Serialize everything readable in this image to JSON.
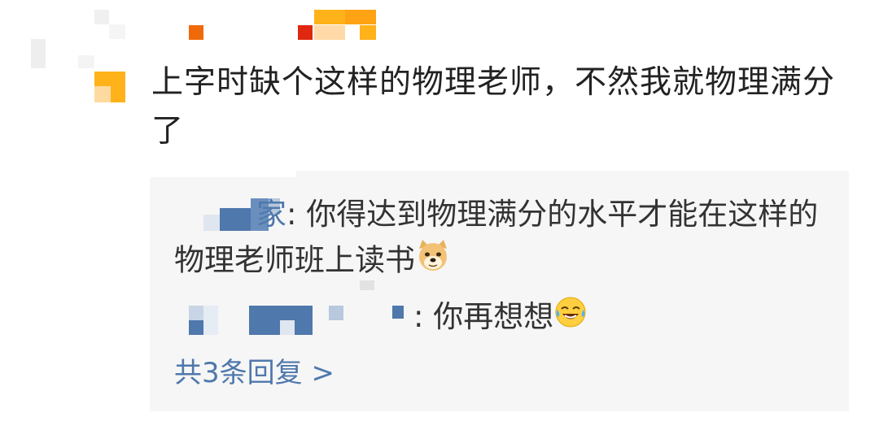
{
  "comment": {
    "text": "上字时缺个这样的物理老师，不然我就物理满分了"
  },
  "replies": [
    {
      "name_fragment": "家",
      "separator": ": ",
      "text": "你得达到物理满分的水平才能在这样的物理老师班上读书",
      "emoji": "doge-icon"
    },
    {
      "name_fragment": "",
      "separator": ": ",
      "text": "你再想想",
      "emoji": "laugh-cry-icon"
    }
  ],
  "more_replies": "共3条回复 >"
}
